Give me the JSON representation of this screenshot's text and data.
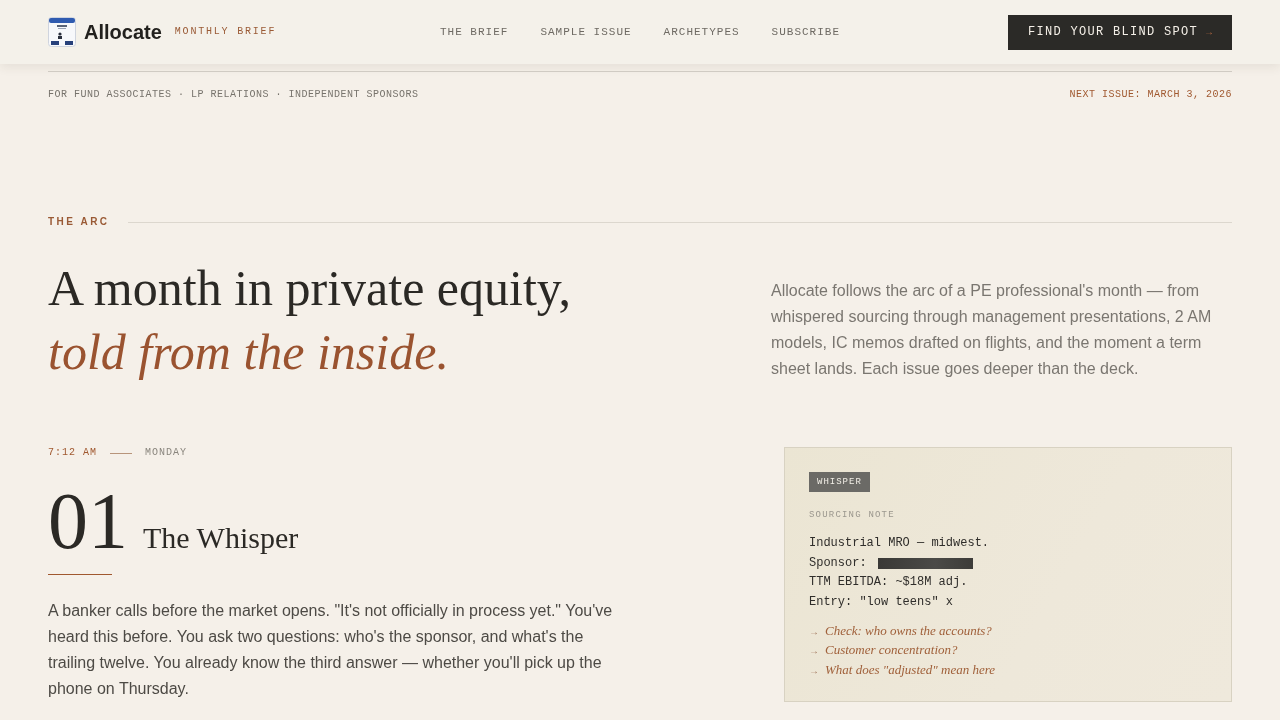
{
  "header": {
    "brand": {
      "name": "Allocate",
      "tagline": "MONTHLY BRIEF"
    },
    "nav": [
      "THE BRIEF",
      "SAMPLE ISSUE",
      "ARCHETYPES",
      "SUBSCRIBE"
    ],
    "cta": {
      "label": "FIND YOUR BLIND SPOT",
      "arrow": "→"
    }
  },
  "subbar": {
    "audience": "FOR FUND ASSOCIATES · LP RELATIONS · INDEPENDENT SPONSORS",
    "next_issue": "NEXT ISSUE: MARCH 3, 2026"
  },
  "arc": {
    "eyebrow": "THE ARC",
    "headline": "A month in private equity,",
    "headline_accent": "told from the inside.",
    "intro": "Allocate follows the arc of a PE professional's month — from whispered sourcing through management presentations, 2 AM models, IC memos drafted on flights, and the moment a term sheet lands. Each issue goes deeper than the deck."
  },
  "chapter": {
    "time": "7:12 AM",
    "day": "MONDAY",
    "number": "01",
    "title": "The Whisper",
    "body": "A banker calls before the market opens. \"It's not officially in process yet.\" You've heard this before. You ask two questions: who's the sponsor, and what's the trailing twelve. You already know the third answer — whether you'll pick up the phone on Thursday.",
    "note": {
      "tag": "WHISPER",
      "label": "SOURCING NOTE",
      "lines": [
        {
          "kind": "text",
          "text": "Industrial MRO — midwest."
        },
        {
          "kind": "redacted",
          "text": "Sponsor:"
        },
        {
          "kind": "text",
          "text": "TTM EBITDA: ~$18M adj."
        },
        {
          "kind": "text",
          "text": "Entry: \"low teens\" x"
        }
      ],
      "questions": [
        {
          "arrow": "→",
          "text": "Check: who owns the accounts?"
        },
        {
          "arrow": "→",
          "text": "Customer concentration?"
        },
        {
          "arrow": "→",
          "text": "What does \"adjusted\" mean here"
        }
      ]
    }
  }
}
